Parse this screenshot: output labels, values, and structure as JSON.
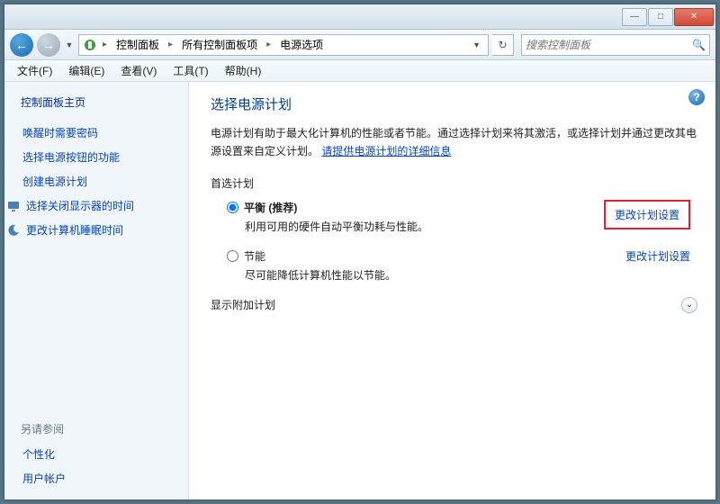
{
  "titlebar": {
    "minimize": "—",
    "maximize": "□",
    "close": "✕"
  },
  "nav": {
    "back_glyph": "←",
    "forward_glyph": "→",
    "dropdown_glyph": "▼",
    "refresh_glyph": "↻"
  },
  "breadcrumbs": {
    "sep": "▸",
    "items": [
      "控制面板",
      "所有控制面板项",
      "电源选项"
    ]
  },
  "search": {
    "placeholder": "搜索控制面板",
    "icon_glyph": "🔍"
  },
  "menubar": [
    "文件(F)",
    "编辑(E)",
    "查看(V)",
    "工具(T)",
    "帮助(H)"
  ],
  "sidebar": {
    "heading": "控制面板主页",
    "links": [
      {
        "label": "唤醒时需要密码",
        "icon": false
      },
      {
        "label": "选择电源按钮的功能",
        "icon": false
      },
      {
        "label": "创建电源计划",
        "icon": false
      },
      {
        "label": "选择关闭显示器的时间",
        "icon": true,
        "icon_name": "monitor-icon"
      },
      {
        "label": "更改计算机睡眠时间",
        "icon": true,
        "icon_name": "sleep-icon"
      }
    ],
    "see_also_label": "另请参阅",
    "see_also": [
      "个性化",
      "用户帐户"
    ]
  },
  "content": {
    "help_glyph": "?",
    "title": "选择电源计划",
    "description_prefix": "电源计划有助于最大化计算机的性能或者节能。通过选择计划来将其激活，或选择计划并通过更改其电源设置来自定义计划。",
    "description_link": "请提供电源计划的详细信息",
    "preferred_label": "首选计划",
    "plans": [
      {
        "name": "平衡 (推荐)",
        "desc": "利用可用的硬件自动平衡功耗与性能。",
        "selected": true,
        "change_link": "更改计划设置",
        "highlight": true
      },
      {
        "name": "节能",
        "desc": "尽可能降低计算机性能以节能。",
        "selected": false,
        "change_link": "更改计划设置",
        "highlight": false
      }
    ],
    "expand_label": "显示附加计划",
    "expand_glyph": "⌄"
  }
}
